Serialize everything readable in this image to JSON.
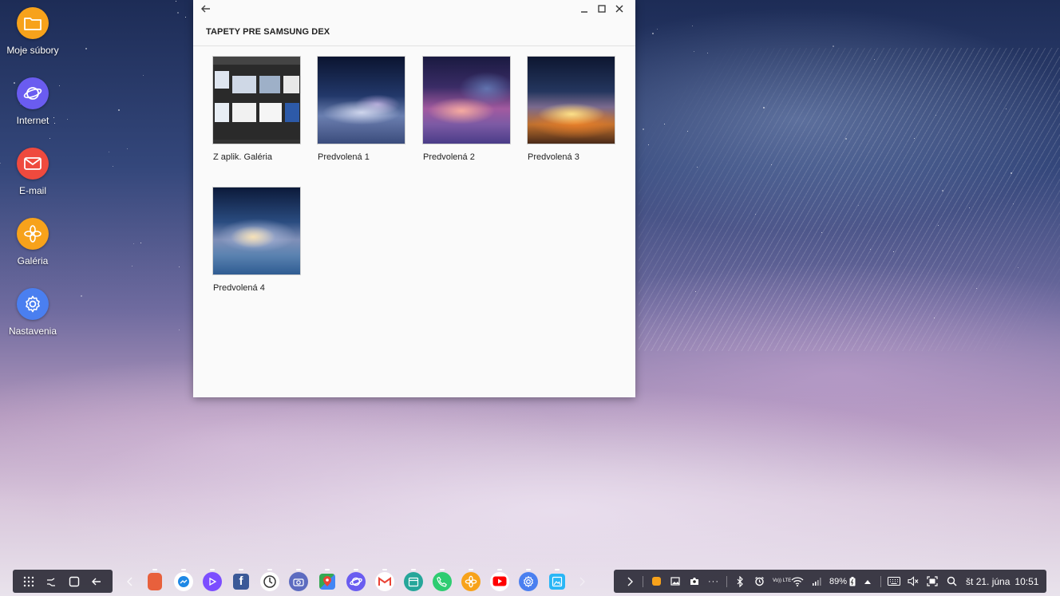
{
  "desktop": {
    "icons": [
      {
        "label": "Moje súbory",
        "icon": "folder-icon",
        "color": "#f7a21b"
      },
      {
        "label": "Internet",
        "icon": "internet-planet-icon",
        "color": "#6a5cf0"
      },
      {
        "label": "E-mail",
        "icon": "email-icon",
        "color": "#ef4a3e"
      },
      {
        "label": "Galéria",
        "icon": "gallery-flower-icon",
        "color": "#f7a21b"
      },
      {
        "label": "Nastavenia",
        "icon": "gear-icon",
        "color": "#4a7ff0"
      }
    ]
  },
  "window": {
    "title": "TAPETY PRE SAMSUNG DEX",
    "tiles": [
      {
        "caption": "Z aplik. Galéria"
      },
      {
        "caption": "Predvolená 1"
      },
      {
        "caption": "Predvolená 2"
      },
      {
        "caption": "Predvolená 3"
      },
      {
        "caption": "Predvolená 4"
      }
    ]
  },
  "taskbar": {
    "nav": [
      "apps-grid-icon",
      "recent-apps-icon",
      "home-icon",
      "back-icon"
    ],
    "apps": [
      {
        "name": "app-1",
        "color": "#e8603c"
      },
      {
        "name": "messenger",
        "color": "#1e88e5"
      },
      {
        "name": "video-player",
        "color": "#7c4dff"
      },
      {
        "name": "facebook",
        "color": "#3b5998"
      },
      {
        "name": "clock",
        "color": "#ffffff"
      },
      {
        "name": "camera",
        "color": "#5c6bc0"
      },
      {
        "name": "maps",
        "color": "#ffffff"
      },
      {
        "name": "internet",
        "color": "#6a5cf0"
      },
      {
        "name": "gmail",
        "color": "#ffffff"
      },
      {
        "name": "calendar",
        "color": "#26a69a"
      },
      {
        "name": "phone",
        "color": "#2ecc71"
      },
      {
        "name": "gallery",
        "color": "#f7a21b"
      },
      {
        "name": "youtube",
        "color": "#ff0000"
      },
      {
        "name": "settings",
        "color": "#4a7ff0"
      },
      {
        "name": "photo-editor",
        "color": "#29b6f6"
      }
    ],
    "status": {
      "battery": "89%",
      "volte": "Vo)) LTE",
      "date": "št 21. júna",
      "time": "10:51"
    }
  }
}
